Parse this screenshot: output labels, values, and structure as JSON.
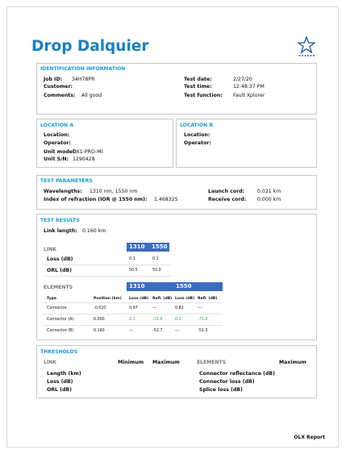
{
  "title": "Drop Dalquier",
  "colors": {
    "accent": "#1a7fc4",
    "header_bar": "#3a6cc2",
    "pass": "#2aa84a"
  },
  "logo_icon": "star-icon",
  "identification": {
    "heading": "IDENTIFICATION INFORMATION",
    "job_id_label": "Job ID:",
    "job_id": "34H78PR",
    "customer_label": "Customer:",
    "customer": "",
    "comments_label": "Comments:",
    "comments": "All good",
    "test_date_label": "Test date:",
    "test_date": "2/27/20",
    "test_time_label": "Test time:",
    "test_time": "12:48:37 PM",
    "test_function_label": "Test function:",
    "test_function": "Fault Xplorer"
  },
  "location_a": {
    "heading": "LOCATION A",
    "location_label": "Location:",
    "location": "",
    "operator_label": "Operator:",
    "operator": "",
    "unit_model_label": "Unit model:",
    "unit_model": "OX1-PRO-MI",
    "unit_sn_label": "Unit S/N:",
    "unit_sn": "1290428"
  },
  "location_b": {
    "heading": "LOCATION B",
    "location_label": "Location:",
    "location": "",
    "operator_label": "Operator:",
    "operator": ""
  },
  "test_parameters": {
    "heading": "TEST PARAMETERS",
    "wavelengths_label": "Wavelengths:",
    "wavelengths": "1310 nm, 1550 nm",
    "ior_label": "Index of refraction (IOR @ 1550 nm):",
    "ior": "1.468325",
    "launch_cord_label": "Launch cord:",
    "launch_cord": "0.021 km",
    "receive_cord_label": "Receive cord:",
    "receive_cord": "0.000 km"
  },
  "test_results": {
    "heading": "TEST RESULTS",
    "link_length_label": "Link length:",
    "link_length": "0.160 km",
    "link": {
      "heading": "LINK",
      "wavelengths": [
        "1310",
        "1550"
      ],
      "rows": [
        {
          "label": "Loss (dB)",
          "values": [
            "0.1",
            "0.1"
          ]
        },
        {
          "label": "ORL (dB)",
          "values": [
            "50.5",
            "50.0"
          ]
        }
      ]
    },
    "elements": {
      "heading": "ELEMENTS",
      "wavelengths": [
        "1310",
        "1550"
      ],
      "columns": [
        "Type",
        "Position (km)",
        "Loss (dB)",
        "Refl. (dB)",
        "Loss (dB)",
        "Refl. (dB)"
      ],
      "rows": [
        {
          "type": "Connector",
          "position": "-0.020",
          "loss1": "0.97",
          "refl1": "---",
          "loss2": "0.82",
          "refl2": "---"
        },
        {
          "type": "Connector (A)",
          "position": "0.000",
          "loss1": "0.1",
          "refl1": "-72.6",
          "loss2": "0.1",
          "refl2": "-71.8"
        },
        {
          "type": "Connector (B)",
          "position": "0.160",
          "loss1": "---",
          "refl1": "-52.7",
          "loss2": "---",
          "refl2": "-51.3"
        }
      ]
    }
  },
  "thresholds": {
    "heading": "THRESHOLDS",
    "link_heading": "LINK",
    "minimum_label": "Minimum",
    "maximum_label": "Maximum",
    "link_rows": [
      "Length (km)",
      "Loss (dB)",
      "ORL (dB)"
    ],
    "elements_heading": "ELEMENTS",
    "elements_maximum_label": "Maximum",
    "element_rows": [
      "Connector reflectance (dB)",
      "Connector loss (dB)",
      "Splice loss (dB)"
    ]
  },
  "footer": "OLX Report"
}
